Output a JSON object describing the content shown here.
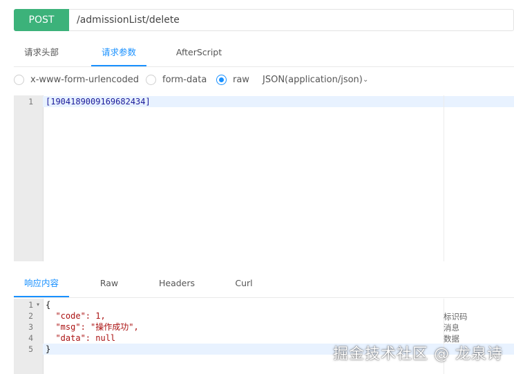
{
  "request": {
    "method": "POST",
    "url": "/admissionList/delete"
  },
  "request_tabs": [
    {
      "label": "请求头部",
      "active": false
    },
    {
      "label": "请求参数",
      "active": true
    },
    {
      "label": "AfterScript",
      "active": false
    }
  ],
  "body_types": {
    "options": [
      {
        "label": "x-www-form-urlencoded",
        "selected": false
      },
      {
        "label": "form-data",
        "selected": false
      },
      {
        "label": "raw",
        "selected": true
      }
    ],
    "content_type": "JSON(application/json)"
  },
  "request_editor": {
    "lines": [
      "1"
    ],
    "body": "[1904189009169682434]"
  },
  "response_tabs": [
    {
      "label": "响应内容",
      "active": true
    },
    {
      "label": "Raw",
      "active": false
    },
    {
      "label": "Headers",
      "active": false
    },
    {
      "label": "Curl",
      "active": false
    }
  ],
  "response_editor": {
    "lines": [
      "1",
      "2",
      "3",
      "4",
      "5"
    ],
    "code_lines": [
      "{",
      "  \"code\": 1,",
      "  \"msg\": \"操作成功\",",
      "  \"data\": null",
      "}"
    ],
    "comments": [
      "标识码",
      "消息",
      "数据"
    ]
  },
  "watermark": "掘金技术社区 @ 龙泉诗",
  "colors": {
    "method_bg": "#3cb27a",
    "accent": "#1890ff",
    "highlight": "#e8f2ff"
  }
}
